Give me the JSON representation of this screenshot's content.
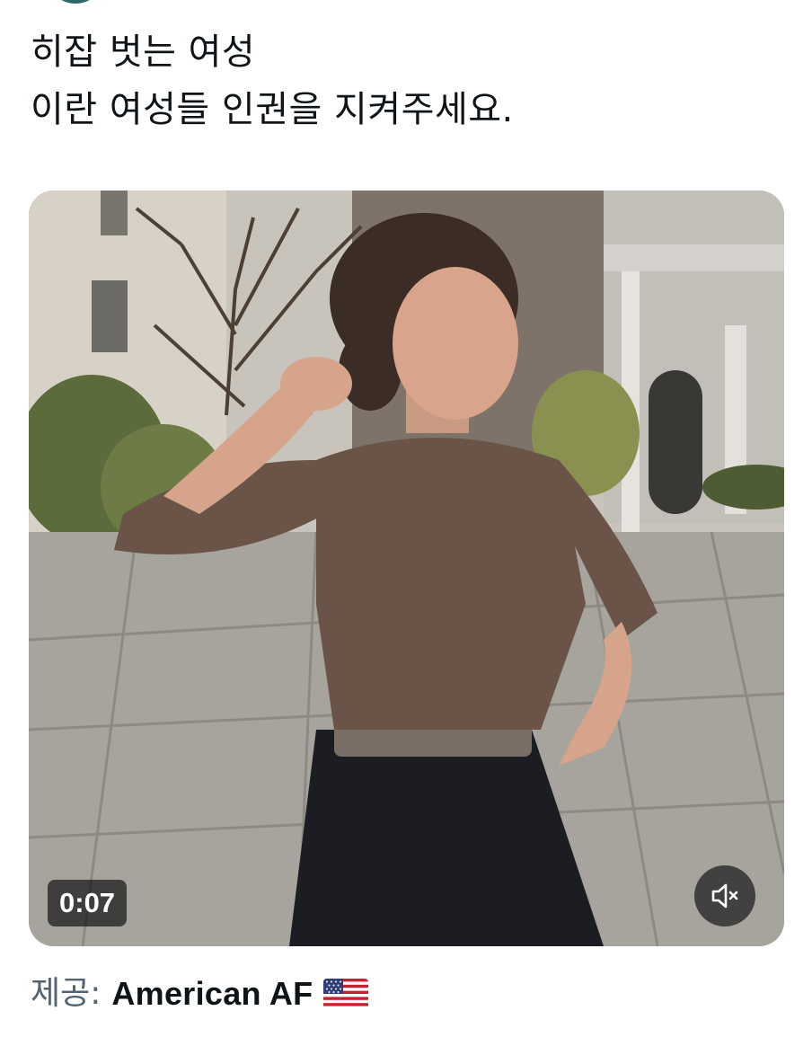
{
  "tweet": {
    "lines": [
      "히잡 벗는 여성",
      "이란 여성들 인권을 지켜주세요."
    ]
  },
  "video": {
    "duration": "0:07",
    "mute_icon": "speaker-muted-icon"
  },
  "attribution": {
    "prefix": "제공:",
    "source": "American AF",
    "flag_icon": "us-flag-icon"
  },
  "colors": {
    "text": "#0f1419",
    "secondary_text": "#536471",
    "badge_bg": "#000000"
  }
}
